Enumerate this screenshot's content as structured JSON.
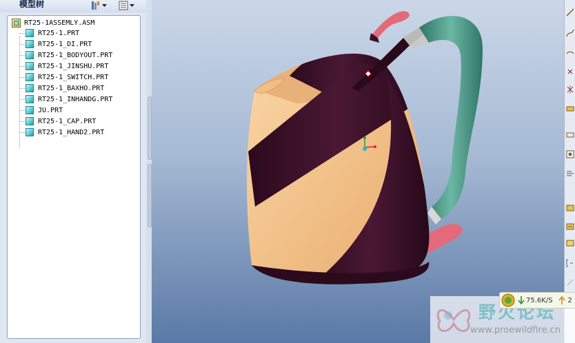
{
  "panel": {
    "title": "模型树",
    "settings_icon": "tree-settings-icon",
    "columns_icon": "tree-columns-icon"
  },
  "tree": {
    "root": "RT25-1ASSEMLY.ASM",
    "items": [
      {
        "label": "RT25-1.PRT"
      },
      {
        "label": "RT25-1_DI.PRT"
      },
      {
        "label": "RT25-1_BODYOUT.PRT"
      },
      {
        "label": "RT25-1_JINSHU.PRT"
      },
      {
        "label": "RT25-1_SWITCH.PRT"
      },
      {
        "label": "RT25-1_BAXHO.PRT"
      },
      {
        "label": "RT25-1_INHANDG.PRT"
      },
      {
        "label": "JU.PRT"
      },
      {
        "label": "RT25-1_CAP.PRT"
      },
      {
        "label": "RT25-1_HAND2.PRT"
      }
    ]
  },
  "viewport": {
    "model": "kettle-3d-model",
    "colors": {
      "body_dark": "#3a1127",
      "body_light": "#f4c48e",
      "handle": "#4f9a88",
      "accent": "#e67a84",
      "bg_top": "#cbd7e8",
      "bg_bottom": "#5a79a6"
    }
  },
  "network": {
    "down": "75.6K/S",
    "up_partial": "2"
  },
  "watermark": {
    "title": "野火论坛",
    "url": "www.proewildfire.cn"
  }
}
